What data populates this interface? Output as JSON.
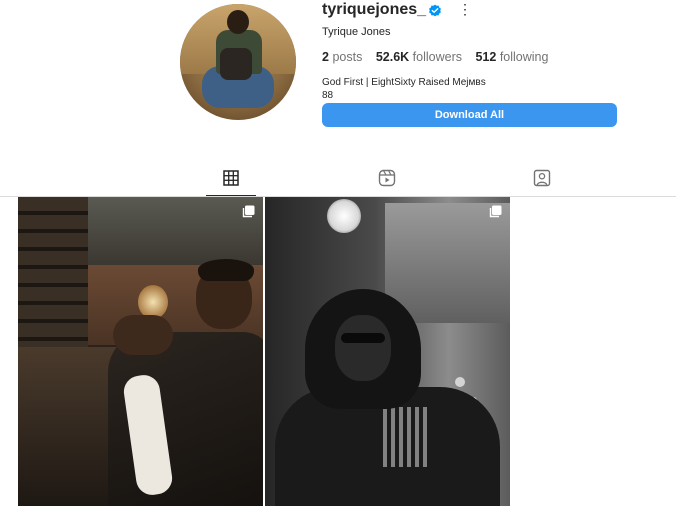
{
  "profile": {
    "username": "tyriquejones_",
    "full_name": "Tyrique Jones",
    "verified": true,
    "stats": {
      "posts_count": "2",
      "posts_label": "posts",
      "followers_count": "52.6K",
      "followers_label": "followers",
      "following_count": "512",
      "following_label": "following"
    },
    "bio_line1": "God First | EightSixty Raised Mејмвs",
    "bio_line2": "88",
    "download_button_label": "Download All"
  },
  "tabs": [
    {
      "icon": "grid-icon",
      "active": true
    },
    {
      "icon": "reels-icon",
      "active": false
    },
    {
      "icon": "tagged-icon",
      "active": false
    }
  ],
  "posts": [
    {
      "type": "carousel",
      "icon": "multiple-posts-icon"
    },
    {
      "type": "carousel",
      "icon": "multiple-posts-icon"
    }
  ],
  "colors": {
    "accent": "#3b96f0",
    "verified": "#0095f6",
    "text": "#262626",
    "secondary_text": "#737373"
  }
}
